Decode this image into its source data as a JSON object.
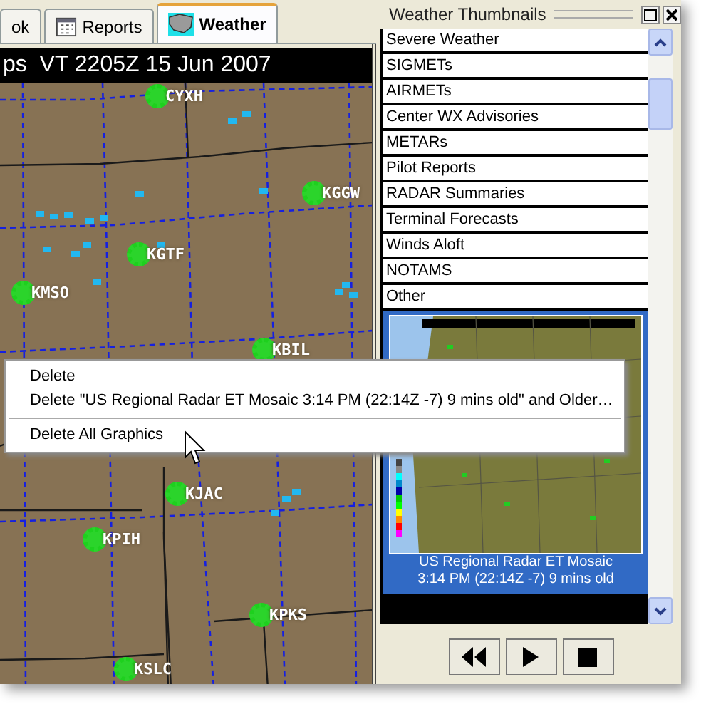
{
  "tabs": [
    {
      "label": "ok",
      "selected": false
    },
    {
      "label": "Reports",
      "selected": false
    },
    {
      "label": "Weather",
      "selected": true
    }
  ],
  "map": {
    "title": "ps  VT 2205Z 15 Jun 2007",
    "stations": [
      "CYXH",
      "KGGW",
      "KGTF",
      "KMSO",
      "KBIL",
      "KJAC",
      "KPIH",
      "KPKS",
      "KSLC"
    ]
  },
  "context_menu": {
    "items": [
      {
        "kind": "item",
        "label": "Delete"
      },
      {
        "kind": "item",
        "label": "Delete \"US Regional Radar ET Mosaic 3:14 PM (22:14Z -7) 9 mins old\" and Older…"
      },
      {
        "kind": "separator"
      },
      {
        "kind": "item",
        "label": "Delete All Graphics"
      }
    ]
  },
  "panel": {
    "title": "Weather Thumbnails",
    "categories": [
      "Severe Weather",
      "SIGMETs",
      "AIRMETs",
      "Center WX Advisories",
      "METARs",
      "Pilot Reports",
      "RADAR Summaries",
      "Terminal Forecasts",
      "Winds Aloft",
      "NOTAMS",
      "Other"
    ],
    "thumbnail": {
      "selected": true,
      "caption": "US Regional Radar ET Mosaic",
      "time": "3:14 PM (22:14Z -7) 9 mins old"
    },
    "controls": [
      {
        "kind": "rewind"
      },
      {
        "kind": "play"
      },
      {
        "kind": "stop"
      }
    ]
  }
}
